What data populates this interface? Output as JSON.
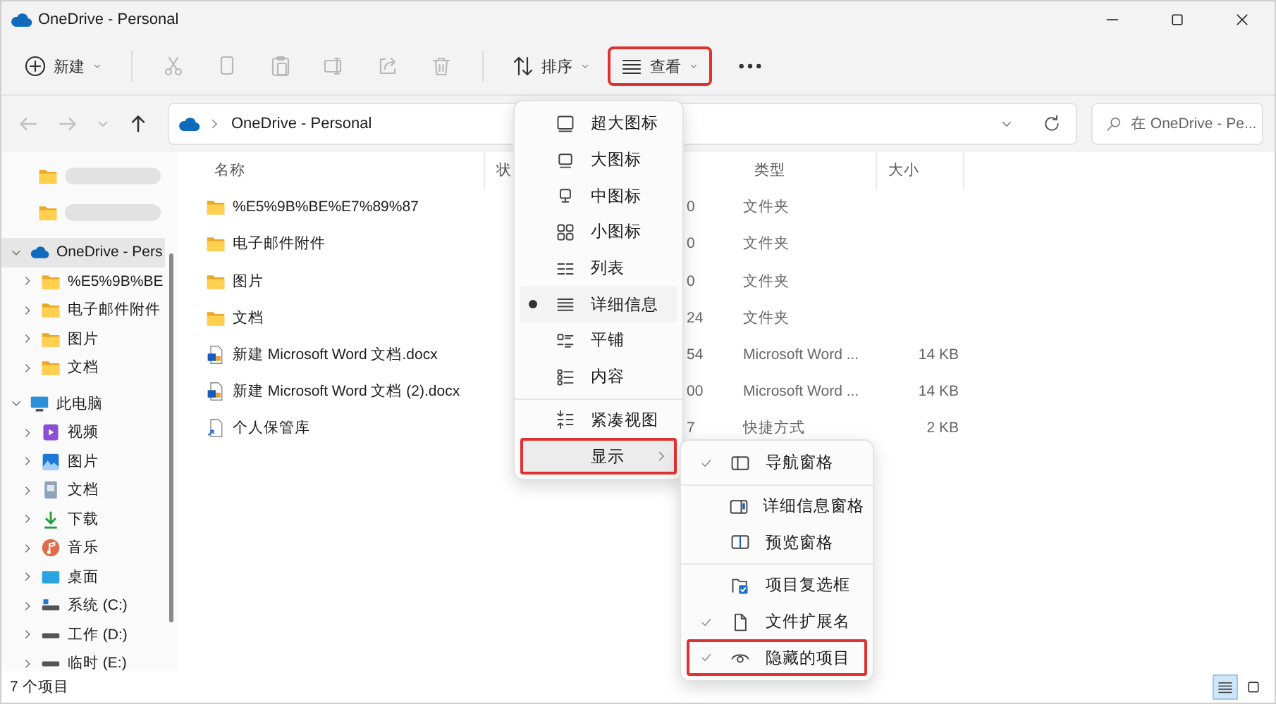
{
  "window": {
    "title": "OneDrive - Personal"
  },
  "toolbar": {
    "items": [
      {
        "kind": "new",
        "label": "新建",
        "dropdown": true,
        "disabled": false,
        "annotated": false
      },
      {
        "kind": "cut",
        "disabled": true
      },
      {
        "kind": "copy",
        "disabled": true
      },
      {
        "kind": "paste",
        "disabled": true
      },
      {
        "kind": "rename",
        "disabled": true
      },
      {
        "kind": "share",
        "disabled": true
      },
      {
        "kind": "delete",
        "disabled": true
      },
      {
        "kind": "sort",
        "label": "排序",
        "dropdown": true,
        "disabled": false,
        "annotated": false
      },
      {
        "kind": "view",
        "label": "查看",
        "dropdown": true,
        "disabled": false,
        "annotated": true
      },
      {
        "kind": "more",
        "disabled": false
      }
    ]
  },
  "nav": [
    {
      "kind": "back",
      "disabled": true
    },
    {
      "kind": "forward",
      "disabled": true
    },
    {
      "kind": "recent",
      "disabled": true
    },
    {
      "kind": "up",
      "disabled": false
    }
  ],
  "address": {
    "path": "OneDrive - Personal"
  },
  "search": {
    "placeholder": "在 OneDrive - Pe..."
  },
  "sidebar": {
    "items": [
      {
        "kind": "folder",
        "redacted": true,
        "selected": false
      },
      {
        "kind": "folder",
        "redacted": true,
        "selected": false
      },
      {
        "kind": "cloud",
        "label": "OneDrive - Pers",
        "expanded": true,
        "selected": true,
        "children": [
          {
            "kind": "folder",
            "label": "%E5%9B%BE",
            "expanded": false,
            "selected": false
          },
          {
            "kind": "folder",
            "label": "电子邮件附件",
            "expanded": false,
            "selected": false
          },
          {
            "kind": "folder",
            "label": "图片",
            "expanded": false,
            "selected": false
          },
          {
            "kind": "folder",
            "label": "文档",
            "expanded": false,
            "selected": false
          }
        ]
      },
      {
        "kind": "pc",
        "label": "此电脑",
        "expanded": true,
        "selected": false,
        "children": [
          {
            "kind": "video",
            "label": "视频",
            "expanded": false,
            "selected": false
          },
          {
            "kind": "pictures",
            "label": "图片",
            "expanded": false,
            "selected": false
          },
          {
            "kind": "docs",
            "label": "文档",
            "expanded": false,
            "selected": false
          },
          {
            "kind": "download",
            "label": "下载",
            "expanded": false,
            "selected": false
          },
          {
            "kind": "music",
            "label": "音乐",
            "expanded": false,
            "selected": false
          },
          {
            "kind": "desktop",
            "label": "桌面",
            "expanded": false,
            "selected": false
          },
          {
            "kind": "system-drive",
            "label": "系统 (C:)",
            "expanded": false,
            "selected": false
          },
          {
            "kind": "drive",
            "label": "工作 (D:)",
            "expanded": false,
            "selected": false
          },
          {
            "kind": "drive",
            "label": "临时 (E:)",
            "expanded": false,
            "selected": false
          }
        ]
      }
    ]
  },
  "table": {
    "columns": [
      {
        "label": "名称"
      },
      {
        "label": "状"
      },
      {
        "label": "类型"
      },
      {
        "label": "大小"
      }
    ],
    "rows": [
      {
        "kind": "folder",
        "name": "%E5%9B%BE%E7%89%87",
        "column_3": "0",
        "type": "文件夹"
      },
      {
        "kind": "folder",
        "name": "电子邮件附件",
        "column_3": "0",
        "type": "文件夹"
      },
      {
        "kind": "folder",
        "name": "图片",
        "column_3": "0",
        "type": "文件夹"
      },
      {
        "kind": "folder",
        "name": "文档",
        "column_3": "24",
        "type": "文件夹"
      },
      {
        "kind": "word",
        "name": "新建 Microsoft Word 文档.docx",
        "column_3": "54",
        "type": "Microsoft Word ...",
        "size": "14 KB"
      },
      {
        "kind": "word",
        "name": "新建 Microsoft Word 文档 (2).docx",
        "column_3": "00",
        "type": "Microsoft Word ...",
        "size": "14 KB"
      },
      {
        "kind": "shortcut",
        "name": "个人保管库",
        "column_3": "7",
        "type": "快捷方式",
        "size": "2 KB"
      }
    ]
  },
  "view_menu": {
    "sections": [
      {
        "items": [
          {
            "kind": "extra-large",
            "label": "超大图标",
            "selected": false
          },
          {
            "kind": "large",
            "label": "大图标",
            "selected": false
          },
          {
            "kind": "medium",
            "label": "中图标",
            "selected": false
          },
          {
            "kind": "small",
            "label": "小图标",
            "selected": false
          },
          {
            "kind": "list",
            "label": "列表",
            "selected": false
          },
          {
            "kind": "details",
            "label": "详细信息",
            "selected": true
          },
          {
            "kind": "tiles",
            "label": "平铺",
            "selected": false
          },
          {
            "kind": "content",
            "label": "内容",
            "selected": false
          }
        ]
      },
      {
        "items": [
          {
            "kind": "compact",
            "label": "紧凑视图",
            "selected": false
          },
          {
            "kind": "submenu",
            "label": "显示",
            "selected": false,
            "annotated": true
          }
        ]
      }
    ]
  },
  "show_menu": {
    "sections": [
      {
        "items": [
          {
            "kind": "nav-pane",
            "label": "导航窗格",
            "checked": true,
            "annotated": false
          }
        ]
      },
      {
        "items": [
          {
            "kind": "details-pane",
            "label": "详细信息窗格",
            "checked": false,
            "annotated": false
          },
          {
            "kind": "preview-pane",
            "label": "预览窗格",
            "checked": false,
            "annotated": false
          }
        ]
      },
      {
        "items": [
          {
            "kind": "checkbox",
            "label": "项目复选框",
            "checked": false,
            "annotated": false
          },
          {
            "kind": "file",
            "label": "文件扩展名",
            "checked": true,
            "annotated": false
          },
          {
            "kind": "eye",
            "label": "隐藏的项目",
            "checked": true,
            "annotated": true
          }
        ]
      }
    ]
  },
  "status_bar": {
    "count": "7 个项目",
    "views": [
      {
        "kind": "details",
        "selected": true
      },
      {
        "kind": "tiles",
        "selected": false
      }
    ]
  }
}
